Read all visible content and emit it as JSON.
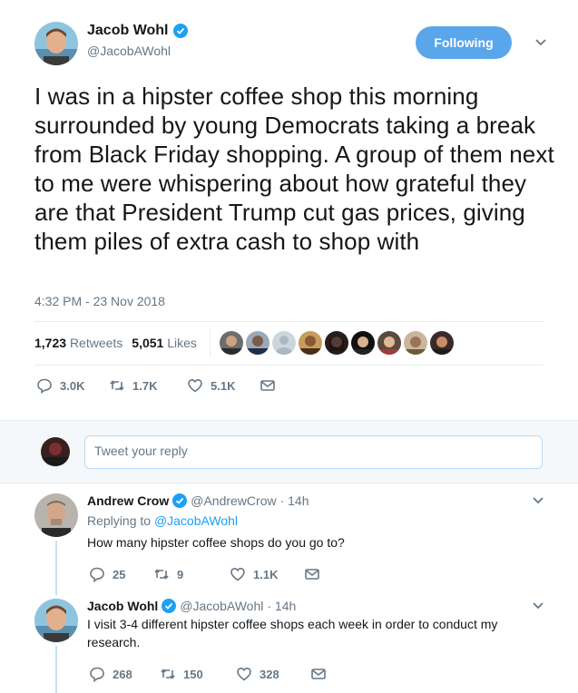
{
  "tweet": {
    "author_name": "Jacob Wohl",
    "author_handle": "@JacobAWohl",
    "follow_label": "Following",
    "text": "I was in a hipster coffee shop this morning surrounded by young Democrats taking a break from Black Friday shopping. A group of them next to me were whispering about how grateful they are that President Trump cut gas prices, giving them piles of extra cash to shop with",
    "timestamp": "4:32 PM - 23 Nov 2018",
    "retweets_count": "1,723",
    "retweets_label": "Retweets",
    "likes_count": "5,051",
    "likes_label": "Likes",
    "replies": "3.0K",
    "retweets_short": "1.7K",
    "likes_short": "5.1K",
    "liker_avatar_count": 9
  },
  "compose": {
    "placeholder": "Tweet your reply"
  },
  "replies": [
    {
      "name": "Andrew Crow",
      "handle": "@AndrewCrow",
      "time": "· 14h",
      "replying_prefix": "Replying to",
      "replying_to": "@JacobAWohl",
      "text": "How many hipster coffee shops do you go to?",
      "reply_count": "25",
      "retweet_count": "9",
      "like_count": "1.1K"
    },
    {
      "name": "Jacob Wohl",
      "handle": "@JacobAWohl",
      "time": "· 14h",
      "text": "I visit 3-4 different hipster coffee shops each week in order to conduct my research.",
      "reply_count": "268",
      "retweet_count": "150",
      "like_count": "328"
    }
  ],
  "colors": {
    "accent": "#1da1f2",
    "follow_bg": "#5aa6ea",
    "muted": "#657786"
  }
}
